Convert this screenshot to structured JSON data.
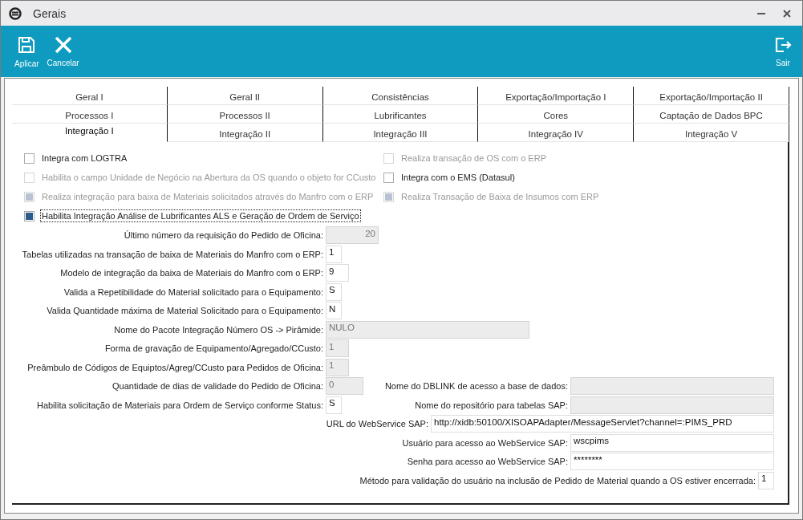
{
  "window": {
    "title": "Gerais"
  },
  "toolbar": {
    "left": [
      {
        "label": "Aplicar",
        "kind": "save"
      },
      {
        "label": "Cancelar",
        "kind": "cancel"
      }
    ],
    "right": [
      {
        "label": "Sair",
        "kind": "exit"
      }
    ]
  },
  "tabs": [
    [
      {
        "label": "Geral I",
        "selected": false
      },
      {
        "label": "Geral II",
        "selected": false
      },
      {
        "label": "Consistências",
        "selected": false
      },
      {
        "label": "Exportação/Importação I",
        "selected": false
      },
      {
        "label": "Exportação/Importação II",
        "selected": false
      }
    ],
    [
      {
        "label": "Processos I",
        "selected": false
      },
      {
        "label": "Processos II",
        "selected": false
      },
      {
        "label": "Lubrificantes",
        "selected": false
      },
      {
        "label": "Cores",
        "selected": false
      },
      {
        "label": "Captação de Dados BPC",
        "selected": false
      }
    ],
    [
      {
        "label": "Integração I",
        "selected": true
      },
      {
        "label": "Integração II",
        "selected": false
      },
      {
        "label": "Integração III",
        "selected": false
      },
      {
        "label": "Integração IV",
        "selected": false
      },
      {
        "label": "Integração V",
        "selected": false
      }
    ]
  ],
  "checkboxes": {
    "left": [
      {
        "label": "Integra com LOGTRA",
        "checked": false,
        "disabled": false,
        "focused": false
      },
      {
        "label": "Habilita o campo Unidade de Negócio na Abertura da OS quando o objeto for CCusto",
        "checked": false,
        "disabled": true,
        "focused": false
      },
      {
        "label": "Realiza integração para baixa de Materiais solicitados através do Manfro com o ERP",
        "checked": true,
        "disabled": true,
        "focused": false
      },
      {
        "label": "Habilita Integração Análise de Lubrificantes ALS e Geração de Ordem de Serviço",
        "checked": true,
        "disabled": false,
        "focused": true
      }
    ],
    "right": [
      {
        "label": "Realiza transação de OS com o ERP",
        "checked": false,
        "disabled": true,
        "focused": false
      },
      {
        "label": "Integra com o EMS (Datasul)",
        "checked": false,
        "disabled": false,
        "focused": false
      },
      {
        "label": "Realiza Transação de Baixa de Insumos com ERP",
        "checked": true,
        "disabled": true,
        "focused": false
      }
    ]
  },
  "form_rows": [
    {
      "left": {
        "label": "Último número da requisição do Pedido de Oficina:",
        "value": "20",
        "disabled": true,
        "kind": "number"
      }
    },
    {
      "left": {
        "label": "Tabelas utilizadas na transação de baixa de Materiais do Manfro com o ERP:",
        "value": "1",
        "disabled": false,
        "kind": "char"
      }
    },
    {
      "left": {
        "label": "Modelo de integração da baixa de Materiais do Manfro com o ERP:",
        "value": "9",
        "disabled": false,
        "kind": "small"
      }
    },
    {
      "left": {
        "label": "Valida a Repetibilidade do Material solicitado para o Equipamento:",
        "value": "S",
        "disabled": false,
        "kind": "char"
      }
    },
    {
      "left": {
        "label": "Valida Quantidade máxima de Material Solicitado para o Equipamento:",
        "value": "N",
        "disabled": false,
        "kind": "char"
      }
    },
    {
      "left": {
        "label": "Nome do Pacote Integração Número OS -> Pirâmide:",
        "value": "NULO",
        "disabled": true,
        "kind": "text"
      }
    },
    {
      "left": {
        "label": "Forma de gravação de Equipamento/Agregado/CCusto:",
        "value": "1",
        "disabled": true,
        "kind": "small"
      }
    },
    {
      "left": {
        "label": "Preâmbulo de Códigos de Equiptos/Agreg/CCusto para Pedidos de Oficina:",
        "value": "1",
        "disabled": true,
        "kind": "small"
      }
    },
    {
      "left": {
        "label": "Quantidade de dias de validade do Pedido de Oficina:",
        "value": "0",
        "disabled": true,
        "kind": "medium"
      },
      "right": {
        "label": "Nome do DBLINK de acesso a base de dados:",
        "disabled": true,
        "kind": "text"
      }
    },
    {
      "left": {
        "label": "Habilita solicitação de Materiais para Ordem de Serviço conforme Status:",
        "value": "S",
        "disabled": false,
        "kind": "char"
      },
      "right": {
        "label": "Nome do repositório para tabelas SAP:",
        "disabled": true,
        "kind": "text"
      }
    },
    {
      "right": {
        "label": "URL do WebService SAP:",
        "value": "http://xidb:50100/XISOAPAdapter/MessageServlet?channel=:PIMS_PRD",
        "disabled": false,
        "kind": "url"
      }
    },
    {
      "right": {
        "label": "Usuário para acesso ao WebService SAP:",
        "value": "wscpims",
        "disabled": false,
        "kind": "text"
      }
    },
    {
      "right": {
        "label": "Senha para acesso ao WebService SAP:",
        "value": "********",
        "disabled": false,
        "kind": "text"
      }
    },
    {
      "right": {
        "label": "Método para validação do usuário na inclusão de Pedido de Material quando a OS estiver encerrada:",
        "value": "1",
        "disabled": false,
        "kind": "char"
      }
    }
  ]
}
